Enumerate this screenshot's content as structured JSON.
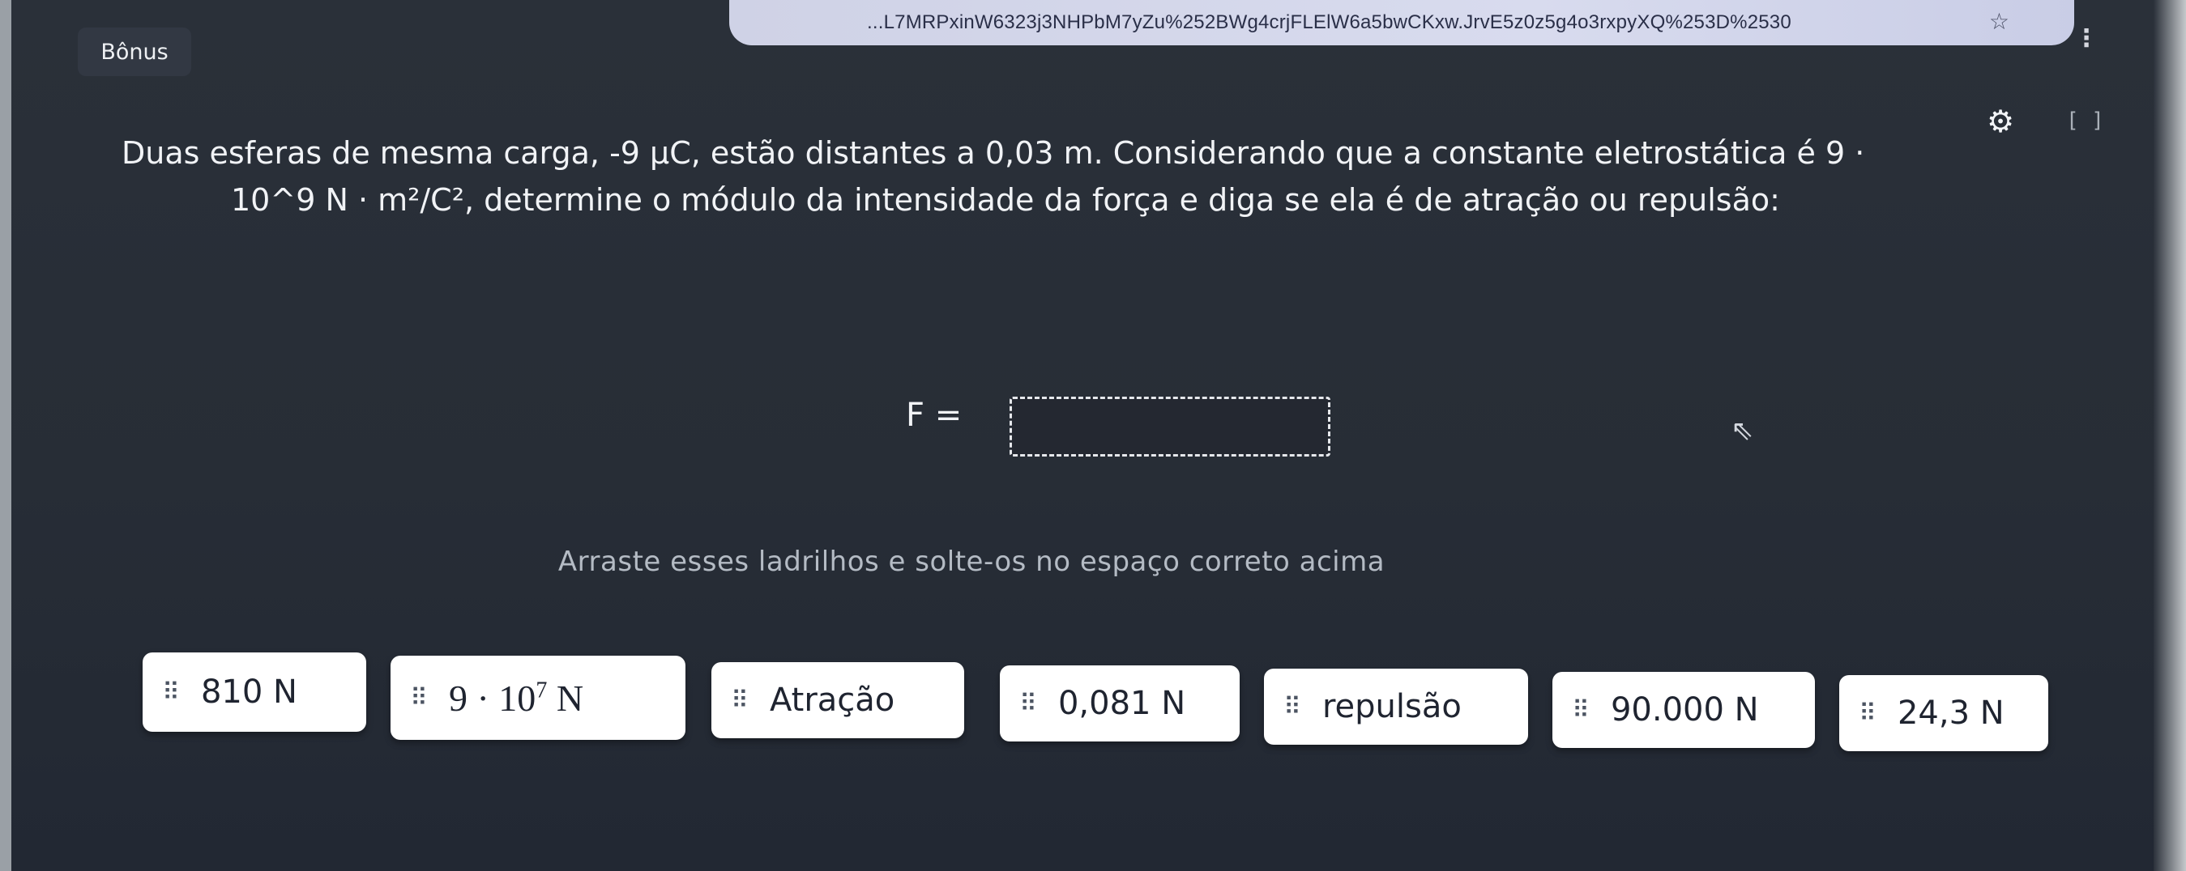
{
  "browser": {
    "url": "...L7MRPxinW6323j3NHPbM7yZu%252BWg4crjFLElW6a5bwCKxw.JrvE5z0z5g4o3rxpyXQ%253D%2530"
  },
  "header": {
    "tab_label": "Bônus"
  },
  "question": {
    "line1": "Duas esferas de mesma carga, -9 µC, estão distantes a 0,03 m. Considerando que a constante eletrostática é 9 ·",
    "line2_prefix": "10^9 N · m²/C²",
    "line2_rest": ", determine o módulo da intensidade da força e diga se ela é de atração ou repulsão:"
  },
  "answer": {
    "formula_label": "F ="
  },
  "instruction": "Arraste esses ladrilhos e solte-os no espaço correto acima",
  "tiles": [
    {
      "label": "810 N"
    },
    {
      "label_base": "9 · 10",
      "label_exp": "7",
      "label_unit": "N"
    },
    {
      "label": "Atração"
    },
    {
      "label": "0,081 N"
    },
    {
      "label": "repulsão"
    },
    {
      "label": "90.000 N"
    },
    {
      "label": "24,3 N"
    }
  ]
}
